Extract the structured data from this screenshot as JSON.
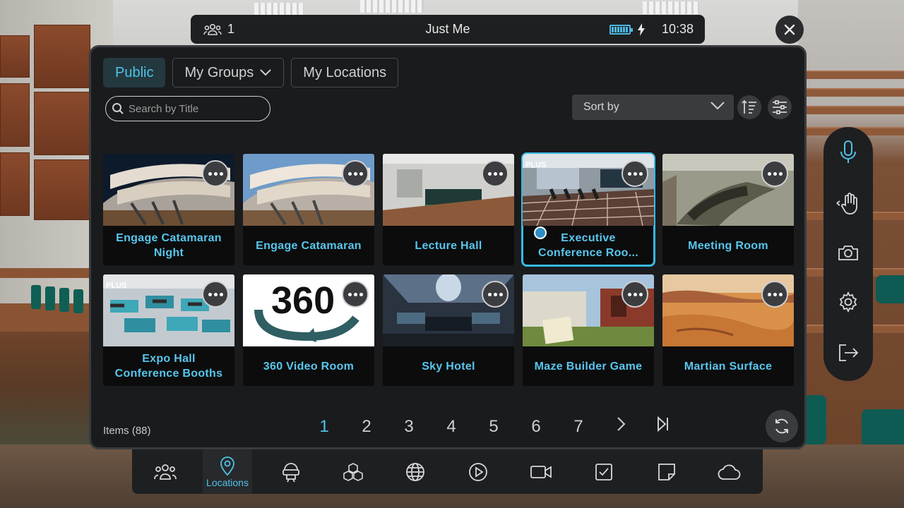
{
  "topbar": {
    "user_count": "1",
    "title": "Just Me",
    "time": "10:38"
  },
  "tabs": [
    {
      "label": "Public",
      "active": true
    },
    {
      "label": "My Groups",
      "active": false
    },
    {
      "label": "My Locations",
      "active": false
    }
  ],
  "search": {
    "placeholder": "Search by Title"
  },
  "sort": {
    "label": "Sort by"
  },
  "cards": [
    {
      "title": "Engage Catamaran Night",
      "line1": "Engage Catamaran",
      "line2": "Night",
      "plus": false,
      "selected": false
    },
    {
      "title": "Engage Catamaran",
      "line1": "Engage Catamaran",
      "line2": "",
      "plus": false,
      "selected": false
    },
    {
      "title": "Lecture Hall",
      "line1": "Lecture Hall",
      "line2": "",
      "plus": false,
      "selected": false
    },
    {
      "title": "Executive Conference Roo...",
      "line1": "Executive",
      "line2": "Conference Roo...",
      "plus": true,
      "selected": true
    },
    {
      "title": "Meeting Room",
      "line1": "Meeting Room",
      "line2": "",
      "plus": false,
      "selected": false
    },
    {
      "title": "Expo Hall Conference Booths",
      "line1": "Expo Hall",
      "line2": "Conference Booths",
      "plus": true,
      "selected": false
    },
    {
      "title": "360 Video Room",
      "line1": "360 Video Room",
      "line2": "",
      "plus": false,
      "selected": false
    },
    {
      "title": "Sky Hotel",
      "line1": "Sky Hotel",
      "line2": "",
      "plus": false,
      "selected": false
    },
    {
      "title": "Maze Builder Game",
      "line1": "Maze Builder Game",
      "line2": "",
      "plus": false,
      "selected": false
    },
    {
      "title": "Martian Surface",
      "line1": "Martian Surface",
      "line2": "",
      "plus": false,
      "selected": false
    }
  ],
  "plus_badge": "PLUS",
  "thumb_360_text": "360",
  "items_count": "Items (88)",
  "pages": [
    "1",
    "2",
    "3",
    "4",
    "5",
    "6",
    "7"
  ],
  "current_page": "1",
  "dock": {
    "active_label": "Locations"
  },
  "colors": {
    "accent": "#4fc3e8",
    "panel_bg": "#1a1b1d",
    "card_bg": "#0c0c0d",
    "selected_outline": "#37b9e2"
  }
}
